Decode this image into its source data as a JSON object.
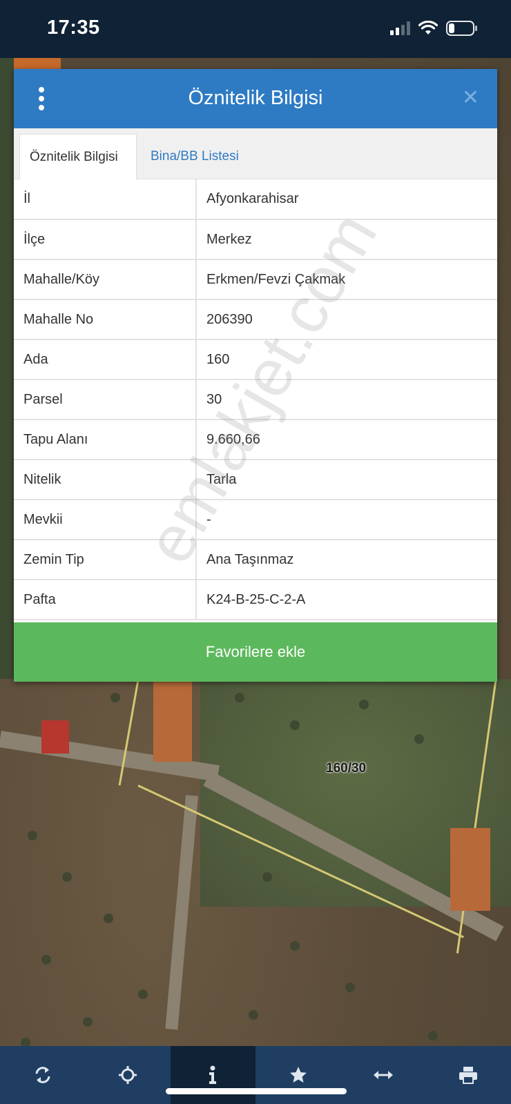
{
  "status_bar": {
    "time": "17:35"
  },
  "modal": {
    "title": "Öznitelik Bilgisi",
    "tabs": [
      {
        "label": "Öznitelik Bilgisi",
        "active": true
      },
      {
        "label": "Bina/BB Listesi",
        "active": false
      }
    ],
    "rows": [
      {
        "key": "İl",
        "value": "Afyonkarahisar"
      },
      {
        "key": "İlçe",
        "value": "Merkez"
      },
      {
        "key": "Mahalle/Köy",
        "value": "Erkmen/Fevzi Çakmak"
      },
      {
        "key": "Mahalle No",
        "value": "206390"
      },
      {
        "key": "Ada",
        "value": "160"
      },
      {
        "key": "Parsel",
        "value": "30"
      },
      {
        "key": "Tapu Alanı",
        "value": "9.660,66"
      },
      {
        "key": "Nitelik",
        "value": "Tarla"
      },
      {
        "key": "Mevkii",
        "value": "-"
      },
      {
        "key": "Zemin Tip",
        "value": "Ana Taşınmaz"
      },
      {
        "key": "Pafta",
        "value": "K24-B-25-C-2-A"
      }
    ],
    "favorite_label": "Favorilere ekle"
  },
  "watermark": "emlakjet.com",
  "map": {
    "parcel_label": "160/30"
  },
  "toolbar": {
    "items": [
      {
        "icon": "refresh-icon",
        "active": false
      },
      {
        "icon": "locate-icon",
        "active": false
      },
      {
        "icon": "info-icon",
        "active": true
      },
      {
        "icon": "star-icon",
        "active": false
      },
      {
        "icon": "measure-icon",
        "active": false
      },
      {
        "icon": "print-icon",
        "active": false
      }
    ]
  },
  "colors": {
    "header_blue": "#2e7bc4",
    "favorite_green": "#5cb85c",
    "toolbar_blue": "#1f3e62",
    "status_bg": "#0f2236"
  }
}
